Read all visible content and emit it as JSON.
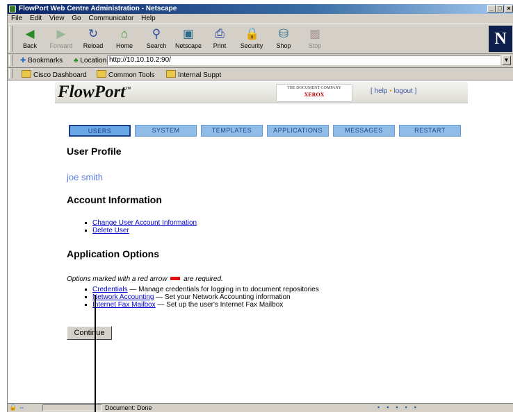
{
  "window": {
    "title": "FlowPort Web Centre Administration - Netscape",
    "controls": {
      "minimize": "_",
      "maximize": "□",
      "close": "×"
    }
  },
  "menubar": [
    "File",
    "Edit",
    "View",
    "Go",
    "Communicator",
    "Help"
  ],
  "toolbar": {
    "buttons": [
      {
        "label": "Back",
        "icon": "back-arrow-icon",
        "glyph": "◀"
      },
      {
        "label": "Forward",
        "icon": "forward-arrow-icon",
        "glyph": "▶"
      },
      {
        "label": "Reload",
        "icon": "reload-icon",
        "glyph": "↻"
      },
      {
        "label": "Home",
        "icon": "home-icon",
        "glyph": "⌂"
      },
      {
        "label": "Search",
        "icon": "search-icon",
        "glyph": "⚲"
      },
      {
        "label": "Netscape",
        "icon": "netscape-icon",
        "glyph": "▣"
      },
      {
        "label": "Print",
        "icon": "print-icon",
        "glyph": "⎙"
      },
      {
        "label": "Security",
        "icon": "security-lock-icon",
        "glyph": "🔒"
      },
      {
        "label": "Shop",
        "icon": "shop-icon",
        "glyph": "⛁"
      },
      {
        "label": "Stop",
        "icon": "stop-icon",
        "glyph": "▩"
      }
    ],
    "logo": "N"
  },
  "location": {
    "bookmarks_label": "Bookmarks",
    "location_label": "Location:",
    "url": "http://10.10.10.2:90/"
  },
  "personal_toolbar": [
    "Cisco Dashboard",
    "Common Tools",
    "Internal Suppt"
  ],
  "flowport": {
    "logo": "FlowPort",
    "logo_tm": "™",
    "company_line": "THE DOCUMENT COMPANY",
    "company_brand": "XEROX",
    "help_link": "help",
    "logout_link": "logout",
    "bullet": "•",
    "bracket_open": "[",
    "bracket_close": "]"
  },
  "tabs": [
    {
      "label": "USERS",
      "active": true
    },
    {
      "label": "SYSTEM",
      "active": false
    },
    {
      "label": "TEMPLATES",
      "active": false
    },
    {
      "label": "APPLICATIONS",
      "active": false
    },
    {
      "label": "MESSAGES",
      "active": false
    },
    {
      "label": "RESTART",
      "active": false
    }
  ],
  "page": {
    "user_profile_heading": "User Profile",
    "username": "joe smith",
    "account_heading": "Account Information",
    "account_links": [
      "Change User Account Information",
      "Delete User"
    ],
    "app_options_heading": "Application Options",
    "options_note_before": "Options marked with a red arrow",
    "options_note_after": "are required.",
    "options": [
      {
        "link": "Credentials",
        "desc": "— Manage credentials for logging in to document repositories"
      },
      {
        "link": "Network Accounting",
        "desc": "— Set your Network Accounting information"
      },
      {
        "link": "Internet Fax Mailbox",
        "desc": "— Set up the user's Internet Fax Mailbox"
      }
    ],
    "continue_label": "Continue"
  },
  "status": {
    "text": "Document: Done"
  },
  "colors": {
    "tab_bg": "#8fbde8",
    "tab_active_border": "#1a3f8a",
    "link": "#0000cc",
    "username": "#5a7de0",
    "required_arrow": "#e01010",
    "xerox_red": "#c00000"
  }
}
